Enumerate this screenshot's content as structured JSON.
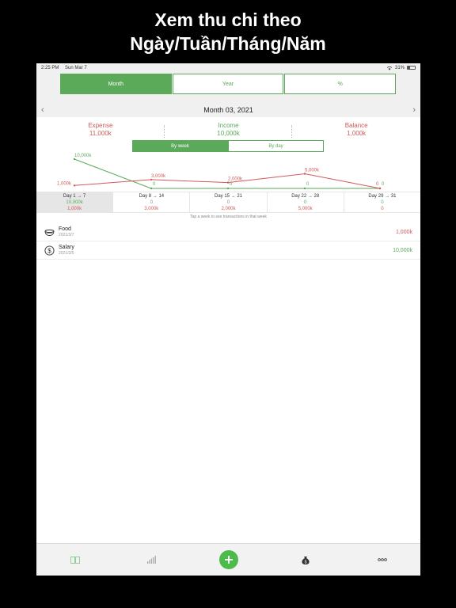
{
  "promo": {
    "line1": "Xem thu chi theo",
    "line2": "Ngày/Tuần/Tháng/Năm"
  },
  "status": {
    "time": "2:25 PM",
    "date": "Sun Mar 7",
    "battery": "31%"
  },
  "segments": [
    {
      "label": "Month",
      "active": true
    },
    {
      "label": "Year",
      "active": false
    },
    {
      "label": "%",
      "active": false
    }
  ],
  "period": {
    "title": "Month 03, 2021"
  },
  "summary": {
    "expense_label": "Expense",
    "expense_value": "11,000k",
    "income_label": "Income",
    "income_value": "10,000k",
    "balance_label": "Balance",
    "balance_value": "1,000k"
  },
  "view_toggle": {
    "by_week": "By week",
    "by_day": "By day"
  },
  "colors": {
    "accent": "#5aaa5a",
    "expense": "#d05a5a",
    "income": "#5aaa5a"
  },
  "chart_data": {
    "type": "line",
    "categories": [
      "Day 1 → 7",
      "Day 8 → 14",
      "Day 15 → 21",
      "Day 22 → 28",
      "Day 29 → 31"
    ],
    "series": [
      {
        "name": "Income",
        "values": [
          10000,
          0,
          0,
          0,
          0
        ],
        "labels": [
          "10,000k",
          "0",
          "0",
          "0",
          "0"
        ]
      },
      {
        "name": "Expense",
        "values": [
          1000,
          3000,
          2000,
          5000,
          0
        ],
        "labels": [
          "1,000k",
          "3,000k",
          "2,000k",
          "5,000k",
          "0"
        ]
      }
    ],
    "ylim": [
      0,
      10000
    ]
  },
  "weeks": [
    {
      "range": "Day 1 → 7",
      "income": "10,000k",
      "expense": "1,000k",
      "selected": true
    },
    {
      "range": "Day 8 → 14",
      "income": "0",
      "expense": "3,000k",
      "selected": false
    },
    {
      "range": "Day 15 → 21",
      "income": "0",
      "expense": "2,000k",
      "selected": false
    },
    {
      "range": "Day 22 → 28",
      "income": "0",
      "expense": "5,000k",
      "selected": false
    },
    {
      "range": "Day 29 → 31",
      "income": "0",
      "expense": "0",
      "selected": false
    }
  ],
  "hint": "Tap a week to see transactions in that week",
  "transactions": [
    {
      "icon": "bowl-icon",
      "name": "Food",
      "date": "2021/3/7",
      "amount": "1,000k",
      "kind": "expense"
    },
    {
      "icon": "dollar-coin-icon",
      "name": "Salary",
      "date": "2021/3/5",
      "amount": "10,000k",
      "kind": "income"
    }
  ],
  "tabbar": [
    "book-icon",
    "chart-bars-icon",
    "add-icon",
    "money-bag-icon",
    "more-icon"
  ]
}
